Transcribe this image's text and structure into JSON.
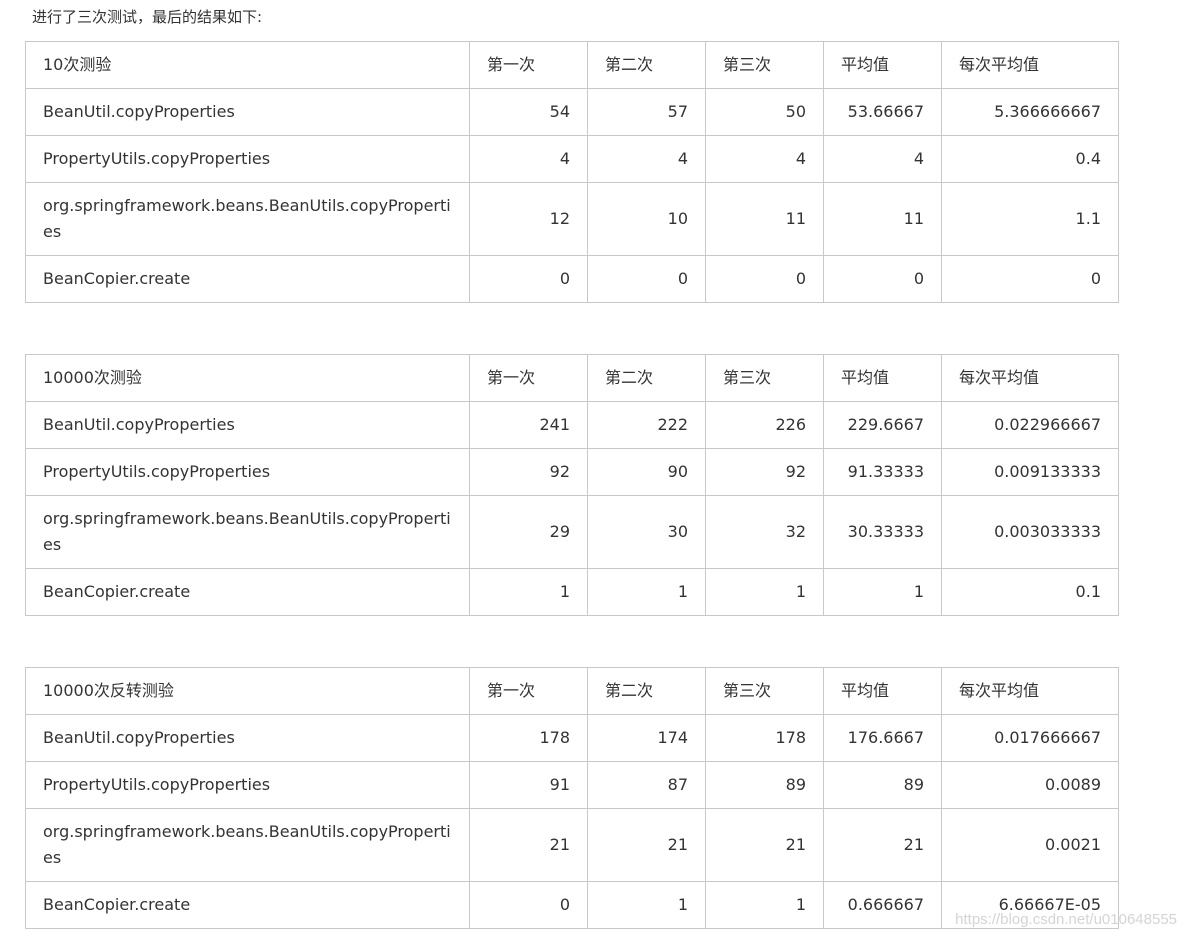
{
  "intro_text": "进行了三次测试，最后的结果如下:",
  "watermark": "https://blog.csdn.net/u010648555",
  "tables": [
    {
      "header": [
        "10次测验",
        "第一次",
        "第二次",
        "第三次",
        "平均值",
        "每次平均值"
      ],
      "rows": [
        [
          "BeanUtil.copyProperties",
          "54",
          "57",
          "50",
          "53.66667",
          "5.366666667"
        ],
        [
          "PropertyUtils.copyProperties",
          "4",
          "4",
          "4",
          "4",
          "0.4"
        ],
        [
          "org.springframework.beans.BeanUtils.copyProperties",
          "12",
          "10",
          "11",
          "11",
          "1.1"
        ],
        [
          "BeanCopier.create",
          "0",
          "0",
          "0",
          "0",
          "0"
        ]
      ]
    },
    {
      "header": [
        "10000次测验",
        "第一次",
        "第二次",
        "第三次",
        "平均值",
        "每次平均值"
      ],
      "rows": [
        [
          "BeanUtil.copyProperties",
          "241",
          "222",
          "226",
          "229.6667",
          "0.022966667"
        ],
        [
          "PropertyUtils.copyProperties",
          "92",
          "90",
          "92",
          "91.33333",
          "0.009133333"
        ],
        [
          "org.springframework.beans.BeanUtils.copyProperties",
          "29",
          "30",
          "32",
          "30.33333",
          "0.003033333"
        ],
        [
          "BeanCopier.create",
          "1",
          "1",
          "1",
          "1",
          "0.1"
        ]
      ]
    },
    {
      "header": [
        "10000次反转测验",
        "第一次",
        "第二次",
        "第三次",
        "平均值",
        "每次平均值"
      ],
      "rows": [
        [
          "BeanUtil.copyProperties",
          "178",
          "174",
          "178",
          "176.6667",
          "0.017666667"
        ],
        [
          "PropertyUtils.copyProperties",
          "91",
          "87",
          "89",
          "89",
          "0.0089"
        ],
        [
          "org.springframework.beans.BeanUtils.copyProperties",
          "21",
          "21",
          "21",
          "21",
          "0.0021"
        ],
        [
          "BeanCopier.create",
          "0",
          "1",
          "1",
          "0.666667",
          "6.66667E-05"
        ]
      ]
    }
  ]
}
